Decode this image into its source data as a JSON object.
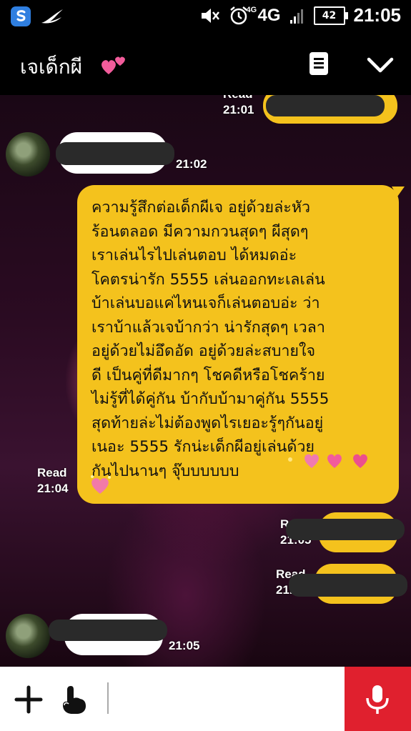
{
  "status_bar": {
    "network_sup": "4G",
    "network": "4G",
    "battery": "42",
    "time": "21:05"
  },
  "header": {
    "title": "เจเด็กผี"
  },
  "messages": [
    {
      "read_label": "Read",
      "time": "21:01"
    },
    {
      "time": "21:02"
    },
    {
      "read_label": "Read",
      "time": "21:04",
      "text": "ความรู้สึกต่อเด็กผีเจ อยู่ด้วยล่ะหัว\nร้อนตลอด มีความกวนสุดๆ ผีสุดๆ\nเราเล่นไรไปเล่นตอบ ได้หมดอ่ะ\nโคตรน่ารัก 5555 เล่นออกทะเลเล่น\nบ้าเล่นบอแค่ไหนเจก็เล่นตอบอ่ะ ว่า\nเราบ้าแล้วเจบ้ากว่า น่ารักสุดๆ เวลา\nอยู่ด้วยไม่อึดอัด อยู่ด้วยล่ะสบายใจ\nดี เป็นคู่ที่ดีมากๆ โชคดีหรือโชคร้าย\nไม่รู้ที่ได้คู่กัน บ้ากับบ้ามาคู่กัน 5555\nสุดท้ายล่ะไม่ต้องพูดไรเยอะรู้ๆกันอยู่\nเนอะ 5555 รักน่ะเด็กผีอยู่เล่นด้วย\nกันไปนานๆ จุ๊บบบบบบ"
    },
    {
      "read_label": "R",
      "time": "21:05"
    },
    {
      "read_label": "Read",
      "time": "21."
    },
    {
      "time": "21:05"
    }
  ],
  "input": {
    "placeholder": ""
  }
}
